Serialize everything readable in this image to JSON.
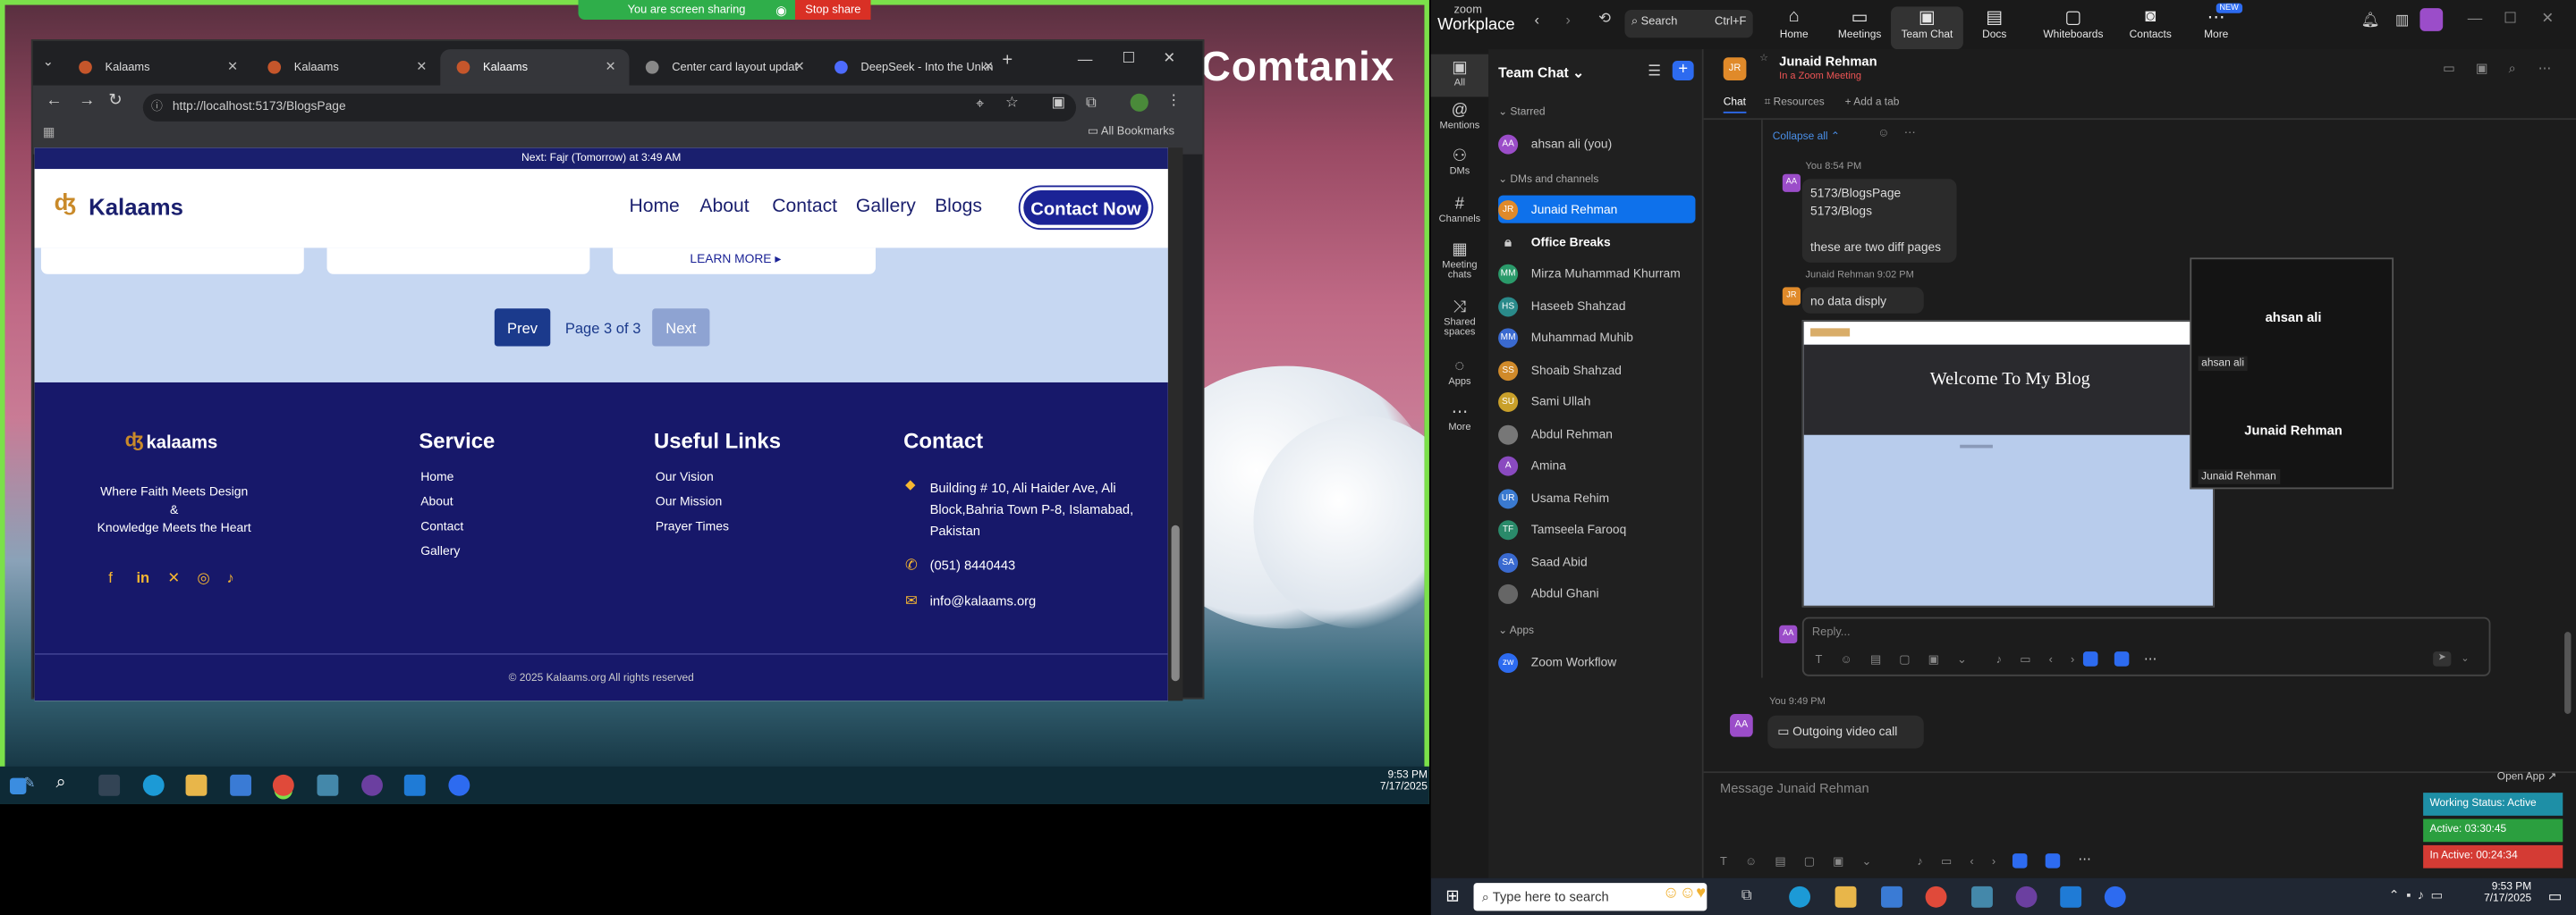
{
  "share": {
    "label": "You are screen sharing",
    "stop": "Stop share"
  },
  "desktop": {
    "brand": "Comtanix"
  },
  "browser": {
    "tabs": [
      {
        "label": "Kalaams"
      },
      {
        "label": "Kalaams"
      },
      {
        "label": "Kalaams"
      },
      {
        "label": "Center card layout updat"
      },
      {
        "label": "DeepSeek - Into the Unkn"
      }
    ],
    "url": "http://localhost:5173/BlogsPage",
    "bookmarks": "All Bookmarks"
  },
  "site": {
    "notice": "Next: Fajr (Tomorrow) at 3:49 AM",
    "logo": "Kalaams",
    "nav": [
      "Home",
      "About",
      "Contact",
      "Gallery",
      "Blogs"
    ],
    "cta": "Contact Now",
    "learn_more": "LEARN MORE ▸",
    "pager": {
      "prev": "Prev",
      "info": "Page 3 of 3",
      "next": "Next"
    },
    "footer": {
      "logo": "kalaams",
      "tagline1": "Where Faith Meets Design",
      "tagline2": "&",
      "tagline3": "Knowledge Meets the Heart",
      "service_h": "Service",
      "service": [
        "Home",
        "About",
        "Contact",
        "Gallery"
      ],
      "links_h": "Useful Links",
      "links": [
        "Our Vision",
        "Our Mission",
        "Prayer Times"
      ],
      "contact_h": "Contact",
      "address": "Building # 10, Ali Haider Ave, Ali Block,Bahria Town P-8, Islamabad, Pakistan",
      "phone": "(051) 8440443",
      "email": "info@kalaams.org",
      "copyright": "© 2025 Kalaams.org All rights reserved"
    }
  },
  "taskbar_left": {
    "time": "9:53 PM",
    "date": "7/17/2025"
  },
  "zoom": {
    "brand1": "zoom",
    "brand2": "Workplace",
    "search": "Search",
    "search_key": "Ctrl+F",
    "nav": [
      "Home",
      "Meetings",
      "Team Chat",
      "Docs",
      "Whiteboards",
      "Contacts",
      "More"
    ],
    "new_badge": "NEW",
    "rail": [
      "All",
      "Mentions",
      "DMs",
      "Channels",
      "Meeting chats",
      "Shared spaces",
      "Apps",
      "More"
    ],
    "list_title": "Team Chat",
    "starred": "Starred",
    "you": "ahsan ali (you)",
    "dms_header": "DMs and channels",
    "contacts": [
      "Junaid Rehman",
      "Office Breaks",
      "Mirza Muhammad Khurram",
      "Haseeb Shahzad",
      "Muhammad Muhib",
      "Shoaib Shahzad",
      "Sami Ullah",
      "Abdul Rehman",
      "Amina",
      "Usama Rehim",
      "Tamseela Farooq",
      "Saad Abid",
      "Abdul Ghani"
    ],
    "apps_header": "Apps",
    "app": "Zoom Workflow",
    "chat_name": "Junaid Rehman",
    "chat_sub": "In a Zoom Meeting",
    "chat_tabs": [
      "Chat",
      "Resources",
      "Add a tab"
    ],
    "collapse": "Collapse all",
    "m1_meta": "You 8:54 PM",
    "m1_lines": [
      "5173/BlogsPage",
      "5173/Blogs",
      "these are two diff pages"
    ],
    "m2_meta": "Junaid Rehman 9:02 PM",
    "m2_text": "no data disply",
    "shot_title": "Welcome To My Blog",
    "participants": [
      {
        "name": "ahsan ali",
        "label": "ahsan ali"
      },
      {
        "name": "Junaid Rehman",
        "label": "Junaid Rehman"
      }
    ],
    "reply_placeholder": "Reply...",
    "m3_meta": "You 9:49 PM",
    "m3_text": "Outgoing video call",
    "message_placeholder": "Message Junaid Rehman",
    "open_app": "Open App",
    "status": {
      "working": "Working Status: Active",
      "active": "Active: 03:30:45",
      "inactive": "In Active: 00:24:34"
    }
  },
  "taskbar_right": {
    "search": "Type here to search",
    "time": "9:53 PM",
    "date": "7/17/2025"
  }
}
